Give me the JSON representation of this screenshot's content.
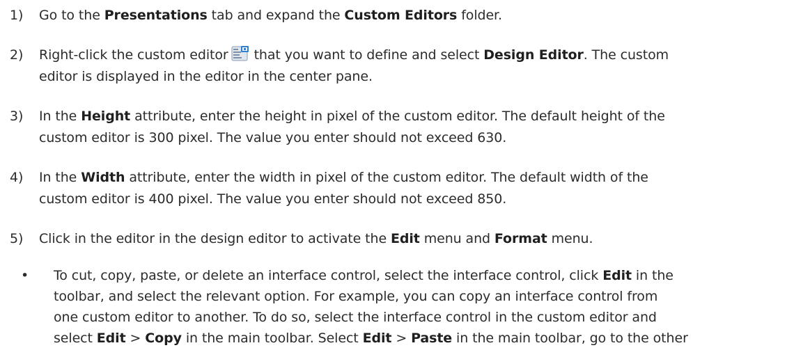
{
  "steps": [
    {
      "number": "1)",
      "parts": {
        "a": "Go to the ",
        "b": "Presentations",
        "c": " tab and expand the ",
        "d": "Custom Editors",
        "e": " folder."
      }
    },
    {
      "number": "2)",
      "parts": {
        "a": "Right-click the custom editor",
        "icon": "custom-editor-icon",
        "b": " that you want to define and select ",
        "c": "Design Editor",
        "d": ". The custom",
        "e": "editor is displayed in the editor in the center pane."
      }
    },
    {
      "number": "3)",
      "parts": {
        "a": "In the ",
        "b": "Height",
        "c": " attribute, enter the height in pixel of the custom editor. The default height of the",
        "d": "custom editor is 300 pixel. The value you enter should not exceed 630."
      }
    },
    {
      "number": "4)",
      "parts": {
        "a": "In the ",
        "b": "Width",
        "c": " attribute, enter the width in pixel of the custom editor. The default width of the",
        "d": "custom editor is 400 pixel. The value you enter should not exceed 850."
      }
    },
    {
      "number": "5)",
      "parts": {
        "a": "Click in the editor in the design editor to activate the ",
        "b": "Edit",
        "c": " menu and ",
        "d": "Format",
        "e": " menu."
      }
    }
  ],
  "bullet": {
    "symbol": "•",
    "line1": {
      "a": "To cut, copy, paste, or delete an interface control, select the interface control, click ",
      "b": "Edit",
      "c": " in the"
    },
    "line2": "toolbar, and select the relevant option. For example, you can copy an interface control from",
    "line3": "one custom editor to another. To do so, select the interface control in the custom editor and",
    "line4": {
      "a": "select ",
      "b": "Edit",
      "c": " > ",
      "d": "Copy",
      "e": " in the main toolbar. Select ",
      "f": "Edit",
      "g": " > ",
      "h": "Paste",
      "i": " in the main toolbar, go to the other"
    }
  }
}
